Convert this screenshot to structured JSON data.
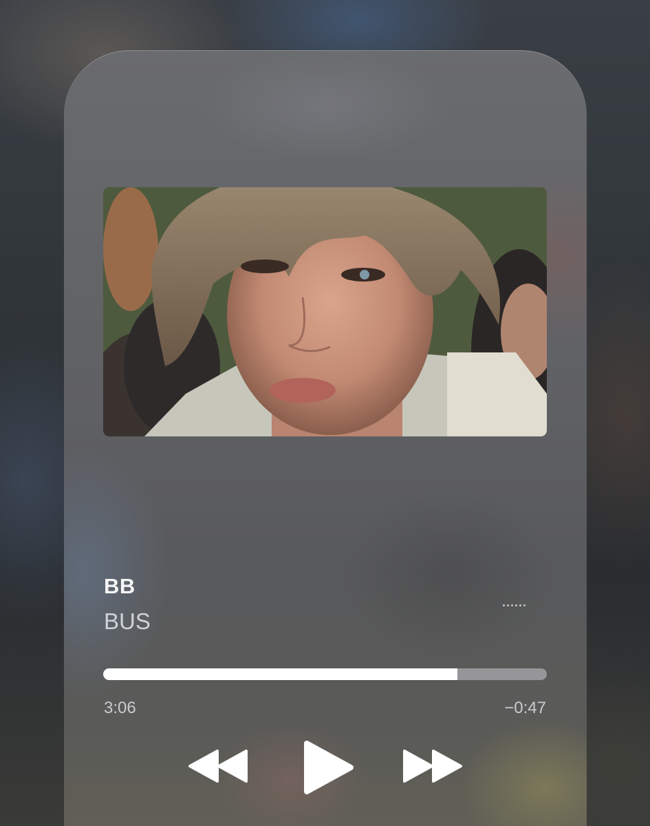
{
  "now_playing": {
    "title": "BB",
    "artist": "BUS",
    "elapsed": "3:06",
    "remaining": "−0:47",
    "progress_fraction": 0.798
  },
  "controls": {
    "rewind_icon": "rewind-icon",
    "play_icon": "play-icon",
    "forward_icon": "fast-forward-icon",
    "more_icon": "more-dots-icon"
  },
  "colors": {
    "progress_fill": "#ffffff",
    "progress_track": "#c8c8cd",
    "text_primary": "#f5f5f5",
    "text_secondary": "#cfd2d6"
  }
}
